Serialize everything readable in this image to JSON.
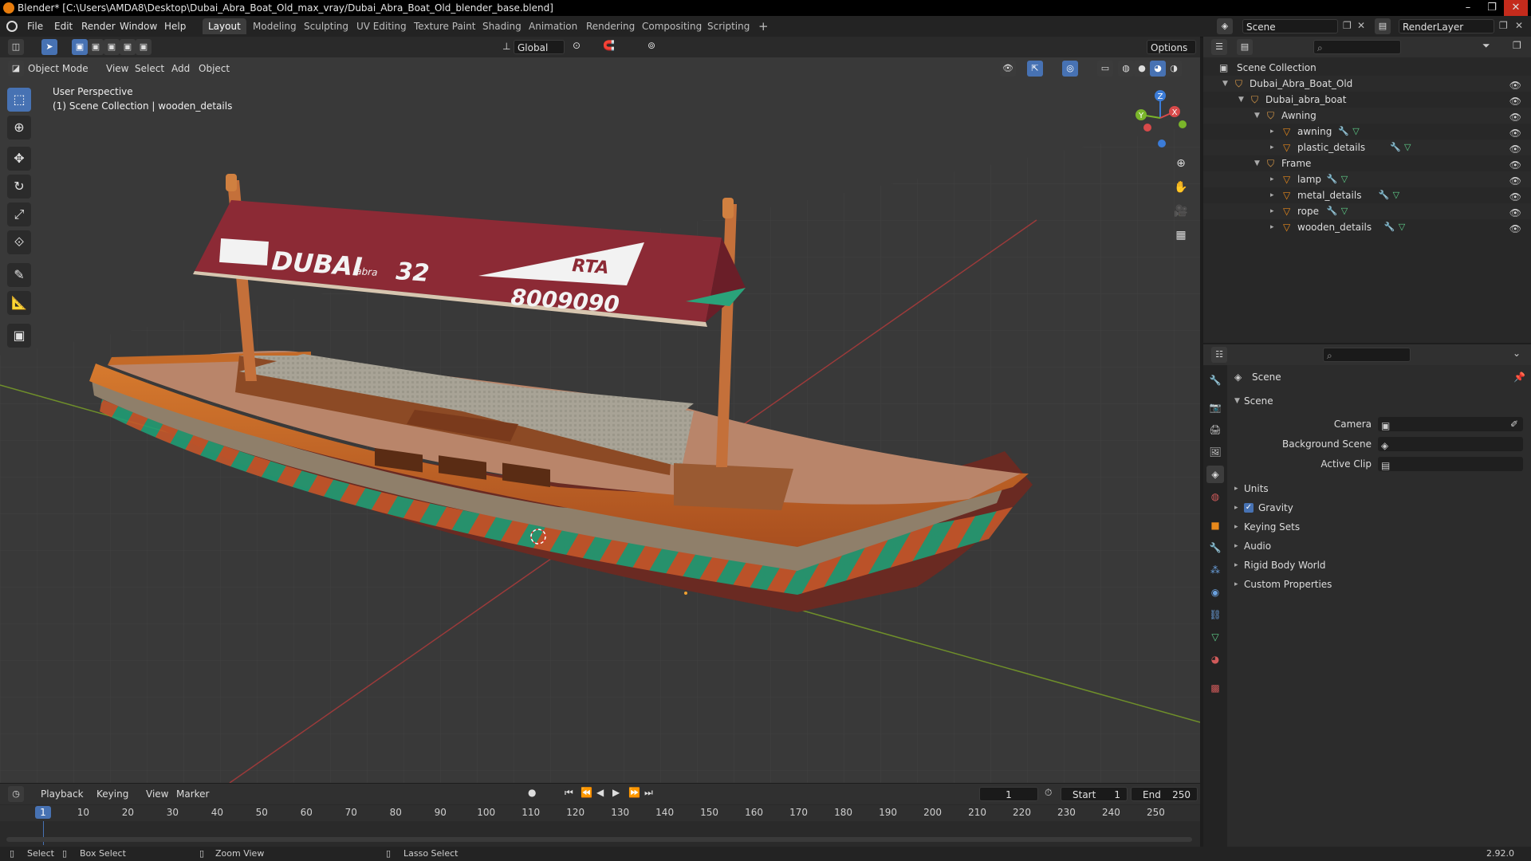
{
  "window": {
    "title": "Blender* [C:\\Users\\AMDA8\\Desktop\\Dubai_Abra_Boat_Old_max_vray/Dubai_Abra_Boat_Old_blender_base.blend]",
    "minimize": "–",
    "maximize": "❐",
    "close": "✕"
  },
  "menu": [
    "File",
    "Edit",
    "Render",
    "Window",
    "Help"
  ],
  "workspaces": [
    "Layout",
    "Modeling",
    "Sculpting",
    "UV Editing",
    "Texture Paint",
    "Shading",
    "Animation",
    "Rendering",
    "Compositing",
    "Scripting"
  ],
  "workspace_add": "+",
  "scene": {
    "name": "Scene",
    "render_layer": "RenderLayer"
  },
  "viewport": {
    "mode": "Object Mode",
    "menus": [
      "View",
      "Select",
      "Add",
      "Object"
    ],
    "orientation": "Global",
    "options": "Options",
    "info_line1": "User Perspective",
    "info_line2": "(1) Scene Collection | wooden_details",
    "gizmo": {
      "x": "X",
      "y": "Y",
      "z": "Z"
    }
  },
  "boat": {
    "awning_text1": "DUBAI",
    "awning_text1b": "abra",
    "awning_number": "32",
    "awning_rta": "RTA",
    "awning_phone": "8009090",
    "colors": {
      "awning": "#8c2a35",
      "hull": "#c46a28",
      "stripe_green": "#1f9c74",
      "deck": "#b9856a",
      "roof": "#a8a396"
    }
  },
  "outliner": {
    "root": "Scene Collection",
    "rows": [
      {
        "label": "Dubai_Abra_Boat_Old",
        "indent": 1,
        "kind": "coll",
        "tri": "▼"
      },
      {
        "label": "Dubai_abra_boat",
        "indent": 2,
        "kind": "coll",
        "tri": "▼"
      },
      {
        "label": "Awning",
        "indent": 3,
        "kind": "coll",
        "tri": "▼"
      },
      {
        "label": "awning",
        "indent": 4,
        "kind": "mesh",
        "tri": "▸"
      },
      {
        "label": "plastic_details",
        "indent": 4,
        "kind": "mesh",
        "tri": "▸"
      },
      {
        "label": "Frame",
        "indent": 3,
        "kind": "coll",
        "tri": "▼"
      },
      {
        "label": "lamp",
        "indent": 4,
        "kind": "mesh",
        "tri": "▸"
      },
      {
        "label": "metal_details",
        "indent": 4,
        "kind": "mesh",
        "tri": "▸"
      },
      {
        "label": "rope",
        "indent": 4,
        "kind": "mesh",
        "tri": "▸"
      },
      {
        "label": "wooden_details",
        "indent": 4,
        "kind": "mesh",
        "tri": "▸"
      }
    ]
  },
  "properties": {
    "context": "Scene",
    "panel": "Scene",
    "fields": [
      {
        "label": "Camera"
      },
      {
        "label": "Background Scene"
      },
      {
        "label": "Active Clip"
      }
    ],
    "sections": [
      "Units",
      "Gravity",
      "Keying Sets",
      "Audio",
      "Rigid Body World",
      "Custom Properties"
    ],
    "gravity_checked": "✓"
  },
  "timeline": {
    "menus": [
      "Playback",
      "Keying",
      "View",
      "Marker"
    ],
    "current_frame": "1",
    "start_label": "Start",
    "start": "1",
    "end_label": "End",
    "end": "250",
    "ticks": [
      "1",
      "10",
      "20",
      "30",
      "40",
      "50",
      "60",
      "70",
      "80",
      "90",
      "100",
      "110",
      "120",
      "130",
      "140",
      "150",
      "160",
      "170",
      "180",
      "190",
      "200",
      "210",
      "220",
      "230",
      "240",
      "250"
    ]
  },
  "statusbar": {
    "select": "Select",
    "box_select": "Box Select",
    "zoom_view": "Zoom View",
    "lasso_select": "Lasso Select",
    "version": "2.92.0"
  }
}
